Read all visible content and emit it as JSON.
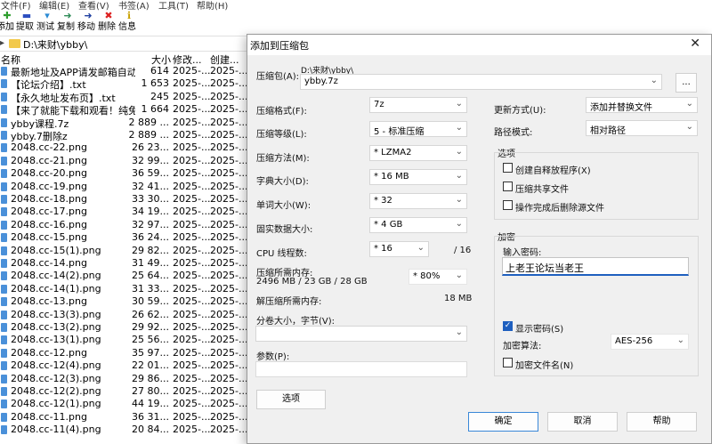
{
  "menu": [
    "文件(F)",
    "编辑(E)",
    "查看(V)",
    "书签(A)",
    "工具(T)",
    "帮助(H)"
  ],
  "toolbar": [
    {
      "label": "添加",
      "icon": "plus-icon"
    },
    {
      "label": "提取",
      "icon": "minus-icon"
    },
    {
      "label": "测试",
      "icon": "check-icon"
    },
    {
      "label": "复制",
      "icon": "copy-arrow-icon"
    },
    {
      "label": "移动",
      "icon": "move-arrow-icon"
    },
    {
      "label": "删除",
      "icon": "delete-x-icon"
    },
    {
      "label": "信息",
      "icon": "info-icon"
    }
  ],
  "address": {
    "path": "D:\\来财\\ybby\\"
  },
  "columns": {
    "name": "名称",
    "size": "大小",
    "modified": "修改...",
    "created": "创建..."
  },
  "files": [
    {
      "name": "最新地址及APP请发邮箱自动...",
      "size": "614",
      "modified": "2025-...",
      "created": "2025-..."
    },
    {
      "name": "【论坛介绍】.txt",
      "size": "1 653",
      "modified": "2025-...",
      "created": "2025-..."
    },
    {
      "name": "【永久地址发布页】.txt",
      "size": "245",
      "modified": "2025-...",
      "created": "2025-..."
    },
    {
      "name": "【来了就能下载和观看！纯免...",
      "size": "1 664",
      "modified": "2025-...",
      "created": "2025-..."
    },
    {
      "name": "ybby课程.7z",
      "size": "2 889 ...",
      "modified": "2025-...",
      "created": "2025-..."
    },
    {
      "name": "ybby.7删除z",
      "size": "2 889 ...",
      "modified": "2025-...",
      "created": "2025-..."
    },
    {
      "name": "2048.cc-22.png",
      "size": "26 23...",
      "modified": "2025-...",
      "created": "2025-..."
    },
    {
      "name": "2048.cc-21.png",
      "size": "32 99...",
      "modified": "2025-...",
      "created": "2025-..."
    },
    {
      "name": "2048.cc-20.png",
      "size": "36 59...",
      "modified": "2025-...",
      "created": "2025-..."
    },
    {
      "name": "2048.cc-19.png",
      "size": "32 41...",
      "modified": "2025-...",
      "created": "2025-..."
    },
    {
      "name": "2048.cc-18.png",
      "size": "33 30...",
      "modified": "2025-...",
      "created": "2025-..."
    },
    {
      "name": "2048.cc-17.png",
      "size": "34 19...",
      "modified": "2025-...",
      "created": "2025-..."
    },
    {
      "name": "2048.cc-16.png",
      "size": "32 97...",
      "modified": "2025-...",
      "created": "2025-..."
    },
    {
      "name": "2048.cc-15.png",
      "size": "36 24...",
      "modified": "2025-...",
      "created": "2025-..."
    },
    {
      "name": "2048.cc-15(1).png",
      "size": "29 82...",
      "modified": "2025-...",
      "created": "2025-..."
    },
    {
      "name": "2048.cc-14.png",
      "size": "31 49...",
      "modified": "2025-...",
      "created": "2025-..."
    },
    {
      "name": "2048.cc-14(2).png",
      "size": "25 64...",
      "modified": "2025-...",
      "created": "2025-..."
    },
    {
      "name": "2048.cc-14(1).png",
      "size": "31 33...",
      "modified": "2025-...",
      "created": "2025-..."
    },
    {
      "name": "2048.cc-13.png",
      "size": "30 59...",
      "modified": "2025-...",
      "created": "2025-..."
    },
    {
      "name": "2048.cc-13(3).png",
      "size": "26 62...",
      "modified": "2025-...",
      "created": "2025-..."
    },
    {
      "name": "2048.cc-13(2).png",
      "size": "29 92...",
      "modified": "2025-...",
      "created": "2025-..."
    },
    {
      "name": "2048.cc-13(1).png",
      "size": "25 56...",
      "modified": "2025-...",
      "created": "2025-..."
    },
    {
      "name": "2048.cc-12.png",
      "size": "35 97...",
      "modified": "2025-...",
      "created": "2025-..."
    },
    {
      "name": "2048.cc-12(4).png",
      "size": "22 01...",
      "modified": "2025-...",
      "created": "2025-..."
    },
    {
      "name": "2048.cc-12(3).png",
      "size": "29 86...",
      "modified": "2025-...",
      "created": "2025-..."
    },
    {
      "name": "2048.cc-12(2).png",
      "size": "27 80...",
      "modified": "2025-...",
      "created": "2025-..."
    },
    {
      "name": "2048.cc-12(1).png",
      "size": "44 19...",
      "modified": "2025-...",
      "created": "2025-..."
    },
    {
      "name": "2048.cc-11.png",
      "size": "36 31...",
      "modified": "2025-...",
      "created": "2025-..."
    },
    {
      "name": "2048.cc-11(4).png",
      "size": "20 84...",
      "modified": "2025-...",
      "created": "2025-..."
    }
  ],
  "dialog": {
    "title": "添加到压缩包",
    "archive_label": "压缩包(A):",
    "archive_dir": "D:\\来财\\ybby\\",
    "archive_name": "ybby.7z",
    "browse": "...",
    "format_label": "压缩格式(F):",
    "format_value": "7z",
    "level_label": "压缩等级(L):",
    "level_value": "5 - 标准压缩",
    "method_label": "压缩方法(M):",
    "method_value": "* LZMA2",
    "dict_label": "字典大小(D):",
    "dict_value": "* 16 MB",
    "word_label": "单词大小(W):",
    "word_value": "* 32",
    "solid_label": "固实数据大小:",
    "solid_value": "* 4 GB",
    "cpu_label": "CPU 线程数:",
    "cpu_value": "* 16",
    "cpu_total": "/ 16",
    "mem_comp_label": "压缩所需内存:",
    "mem_comp_value": "2496 MB / 23 GB / 28 GB",
    "mem_percent": "* 80%",
    "mem_decomp_label": "解压缩所需内存:",
    "mem_decomp_value": "18 MB",
    "split_label": "分卷大小，字节(V):",
    "split_value": "",
    "params_label": "参数(P):",
    "params_value": "",
    "options_button": "选项",
    "update_label": "更新方式(U):",
    "update_value": "添加并替换文件",
    "pathmode_label": "路径模式:",
    "pathmode_value": "相对路径",
    "options_group": "选项",
    "opt_sfx": "创建自释放程序(X)",
    "opt_shared": "压缩共享文件",
    "opt_delete": "操作完成后删除源文件",
    "encrypt_group": "加密",
    "password_label": "输入密码:",
    "password_value": "上老王论坛当老王",
    "show_password": "显示密码(S)",
    "enc_method_label": "加密算法:",
    "enc_method_value": "AES-256",
    "enc_names": "加密文件名(N)",
    "ok": "确定",
    "cancel": "取消",
    "help": "帮助",
    "close": "✕"
  }
}
